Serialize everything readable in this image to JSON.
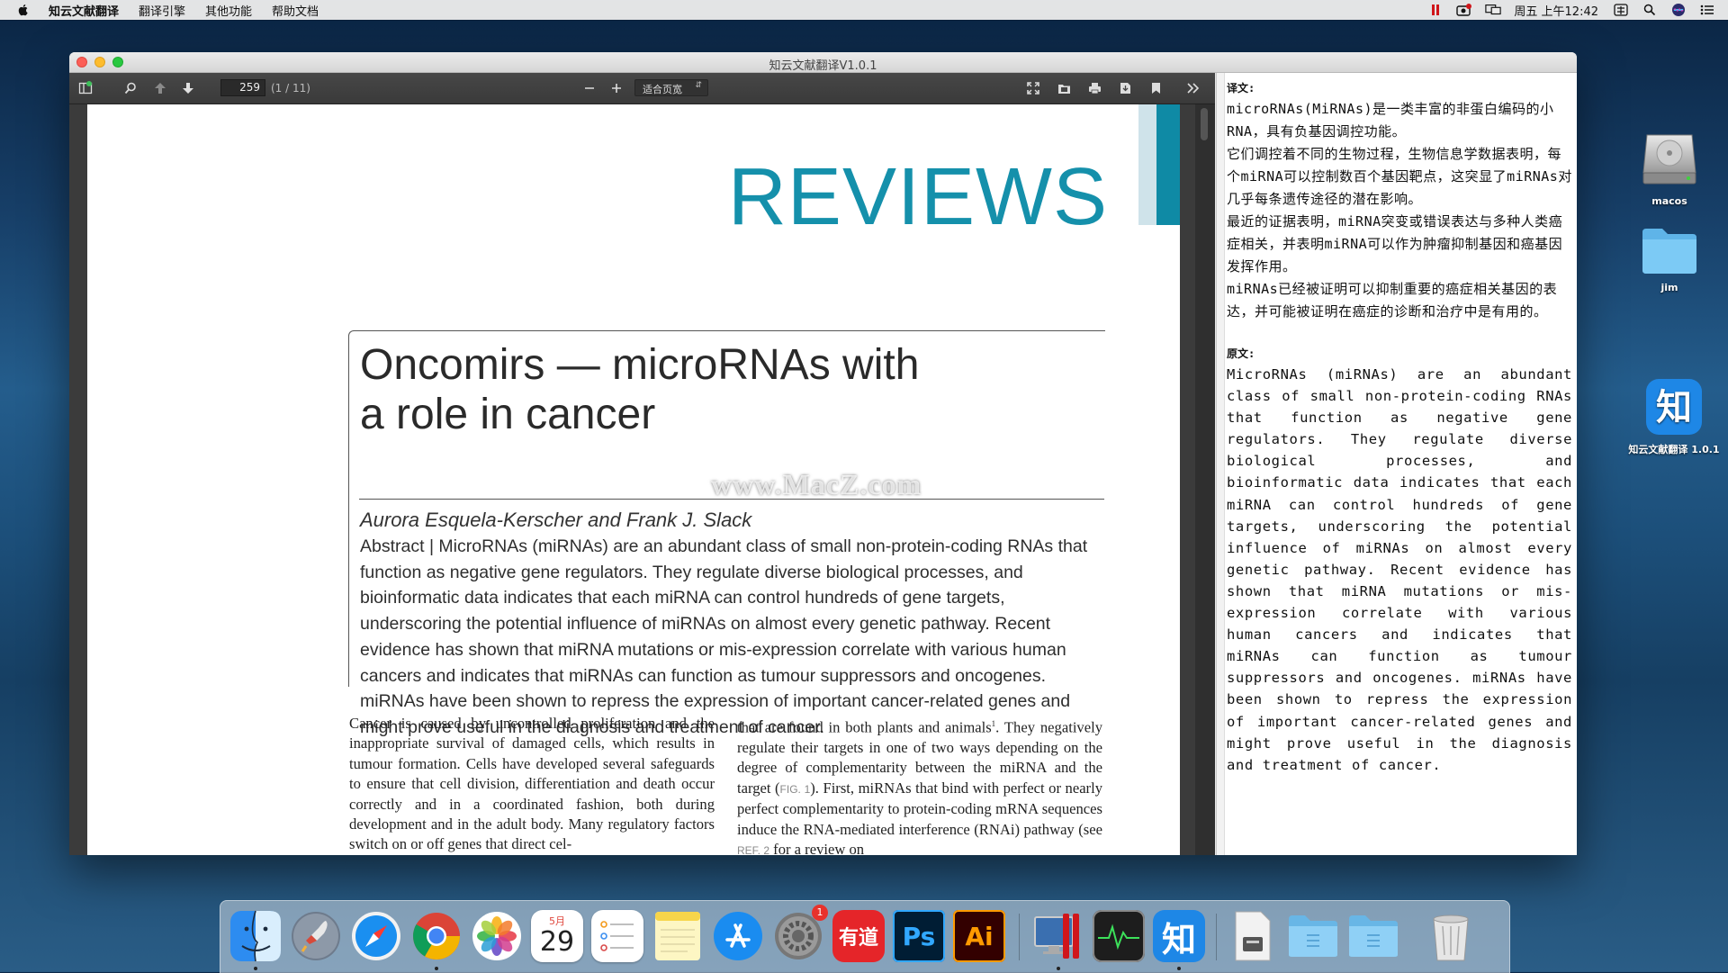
{
  "menubar": {
    "app_name": "知云文献翻译",
    "items": [
      "翻译引擎",
      "其他功能",
      "帮助文档"
    ],
    "clock": "周五 上午12:42"
  },
  "desktop": {
    "icons": [
      {
        "label": "macos"
      },
      {
        "label": "jim"
      },
      {
        "label": "知云文献翻译 1.0.1"
      }
    ]
  },
  "window": {
    "title": "知云文献翻译V1.0.1"
  },
  "toolbar": {
    "page_number": "259",
    "page_count": "(1 / 11)",
    "zoom_option": "适合页宽"
  },
  "document": {
    "section_label": "REVIEWS",
    "title_line1": "Oncomirs — microRNAs with",
    "title_line2": "a role in cancer",
    "authors": "Aurora Esquela-Kerscher and Frank J. Slack",
    "abstract": "Abstract | MicroRNAs (miRNAs) are an abundant class of small non-protein-coding RNAs that function as negative gene regulators. They regulate diverse biological processes, and bioinformatic data indicates that each miRNA can control hundreds of gene targets, underscoring the potential influence of miRNAs on almost every genetic pathway. Recent evidence has shown that miRNA mutations or mis-expression correlate with various human cancers and indicates that miRNAs can function as tumour suppressors and oncogenes. miRNAs have been shown to repress the expression of important cancer-related genes and might prove useful in the diagnosis and treatment of cancer.",
    "col1": "Cancer is caused by uncontrolled proliferation and the inappropriate survival of damaged cells, which results in tumour formation. Cells have developed several safeguards to ensure that cell division, differentiation and death occur correctly and in a coordinated fashion, both during development and in the adult body. Many regulatory factors switch on or off genes that direct cel-",
    "col2_a": "that are found in both plants and animals",
    "col2_sup": "1",
    "col2_b": ". They negatively regulate their targets in one of two ways depending on the degree of complementarity between the miRNA and the target (",
    "col2_fig": "FIG. 1",
    "col2_c": "). First, miRNAs that bind with perfect or nearly perfect complementarity to protein-coding mRNA sequences induce the RNA-mediated interference (RNAi) pathway (see ",
    "col2_ref": "REF. 2",
    "col2_d": " for a review on"
  },
  "watermark": "www.MacZ.com",
  "translation": {
    "translated_heading": "译文:",
    "translated_paragraphs": [
      "microRNAs(MiRNAs)是一类丰富的非蛋白编码的小RNA，具有负基因调控功能。",
      "它们调控着不同的生物过程，生物信息学数据表明，每个miRNA可以控制数百个基因靶点，这突显了miRNAs对几乎每条遗传途径的潜在影响。",
      "最近的证据表明，miRNA突变或错误表达与多种人类癌症相关，并表明miRNA可以作为肿瘤抑制基因和癌基因发挥作用。",
      "miRNAs已经被证明可以抑制重要的癌症相关基因的表达，并可能被证明在癌症的诊断和治疗中是有用的。"
    ],
    "original_heading": "原文:",
    "original_text": "MicroRNAs (miRNAs) are an abundant class of small non-protein-coding RNAs that function as negative gene regulators. They regulate diverse biological processes, and bioinformatic data indicates that each miRNA can control hundreds of gene targets, underscoring the potential influence of miRNAs on almost every genetic pathway. Recent evidence has shown that miRNA mutations or mis-expression correlate with various human cancers and indicates that miRNAs can function as tumour suppressors and oncogenes. miRNAs have been shown to repress the expression of important cancer-related genes and might prove useful in the diagnosis and treatment of cancer."
  },
  "dock": {
    "calendar_month": "5月",
    "calendar_day": "29",
    "notification_badge": "1",
    "youdao_label": "有道",
    "photoshop_label": "Ps",
    "illustrator_label": "Ai",
    "zhiyun_label": "知"
  }
}
